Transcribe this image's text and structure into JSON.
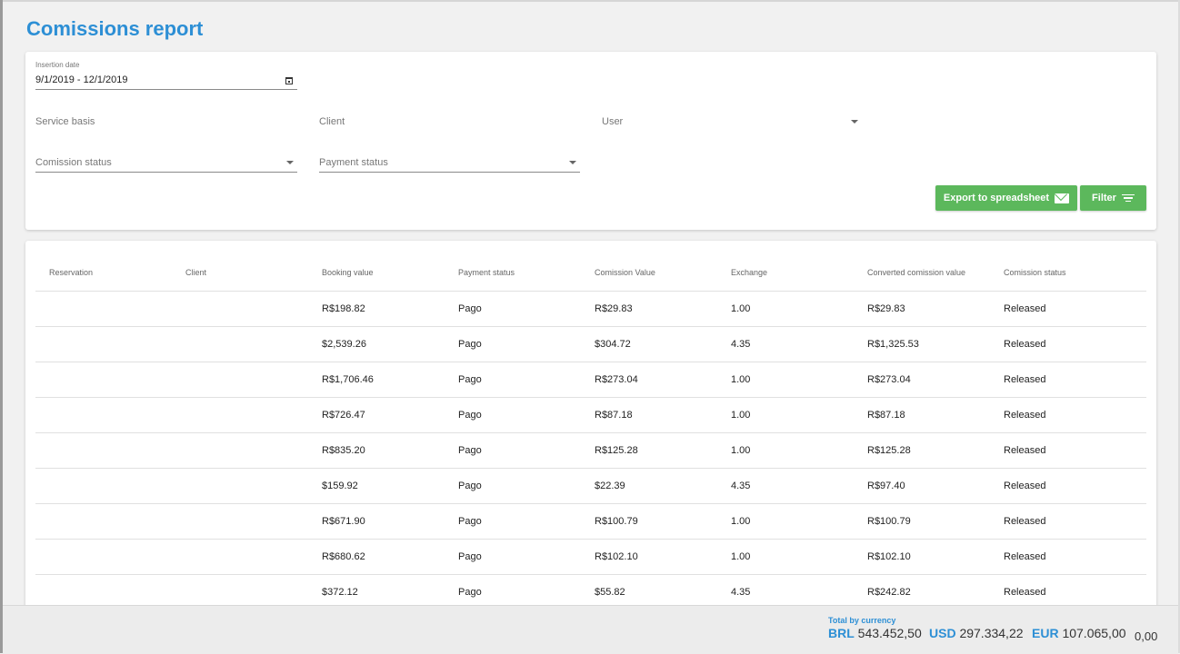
{
  "page": {
    "title": "Comissions report"
  },
  "filters": {
    "insertion_date": {
      "label": "Insertion date",
      "value": "9/1/2019 - 12/1/2019"
    },
    "service_basis": {
      "placeholder": "Service basis"
    },
    "client": {
      "placeholder": "Client"
    },
    "user": {
      "placeholder": "User"
    },
    "comission_status": {
      "placeholder": "Comission status"
    },
    "payment_status": {
      "placeholder": "Payment status"
    }
  },
  "actions": {
    "export_label": "Export to spreadsheet",
    "filter_label": "Filter",
    "button_color": "#5cb85c"
  },
  "table": {
    "columns": [
      "Reservation",
      "Client",
      "Booking value",
      "Payment status",
      "Comission Value",
      "Exchange",
      "Converted comission value",
      "Comission status"
    ],
    "rows": [
      {
        "reservation": "",
        "client": "",
        "booking_value": "R$198.82",
        "payment_status": "Pago",
        "comission_value": "R$29.83",
        "exchange": "1.00",
        "converted": "R$29.83",
        "status": "Released"
      },
      {
        "reservation": "",
        "client": "",
        "booking_value": "$2,539.26",
        "payment_status": "Pago",
        "comission_value": "$304.72",
        "exchange": "4.35",
        "converted": "R$1,325.53",
        "status": "Released"
      },
      {
        "reservation": "",
        "client": "",
        "booking_value": "R$1,706.46",
        "payment_status": "Pago",
        "comission_value": "R$273.04",
        "exchange": "1.00",
        "converted": "R$273.04",
        "status": "Released"
      },
      {
        "reservation": "",
        "client": "",
        "booking_value": "R$726.47",
        "payment_status": "Pago",
        "comission_value": "R$87.18",
        "exchange": "1.00",
        "converted": "R$87.18",
        "status": "Released"
      },
      {
        "reservation": "",
        "client": "",
        "booking_value": "R$835.20",
        "payment_status": "Pago",
        "comission_value": "R$125.28",
        "exchange": "1.00",
        "converted": "R$125.28",
        "status": "Released"
      },
      {
        "reservation": "",
        "client": "",
        "booking_value": "$159.92",
        "payment_status": "Pago",
        "comission_value": "$22.39",
        "exchange": "4.35",
        "converted": "R$97.40",
        "status": "Released"
      },
      {
        "reservation": "",
        "client": "",
        "booking_value": "R$671.90",
        "payment_status": "Pago",
        "comission_value": "R$100.79",
        "exchange": "1.00",
        "converted": "R$100.79",
        "status": "Released"
      },
      {
        "reservation": "",
        "client": "",
        "booking_value": "R$680.62",
        "payment_status": "Pago",
        "comission_value": "R$102.10",
        "exchange": "1.00",
        "converted": "R$102.10",
        "status": "Released"
      },
      {
        "reservation": "",
        "client": "",
        "booking_value": "$372.12",
        "payment_status": "Pago",
        "comission_value": "$55.82",
        "exchange": "4.35",
        "converted": "R$242.82",
        "status": "Released"
      }
    ]
  },
  "footer": {
    "totals_label": "Total by currency",
    "totals": [
      {
        "currency": "BRL",
        "amount": "543.452,50"
      },
      {
        "currency": "USD",
        "amount": "297.334,22"
      },
      {
        "currency": "EUR",
        "amount": "107.065,00"
      }
    ],
    "grand_total": "0,00"
  },
  "colors": {
    "accent": "#2d8fd5",
    "button": "#5cb85c",
    "background": "#f1f1f1"
  }
}
